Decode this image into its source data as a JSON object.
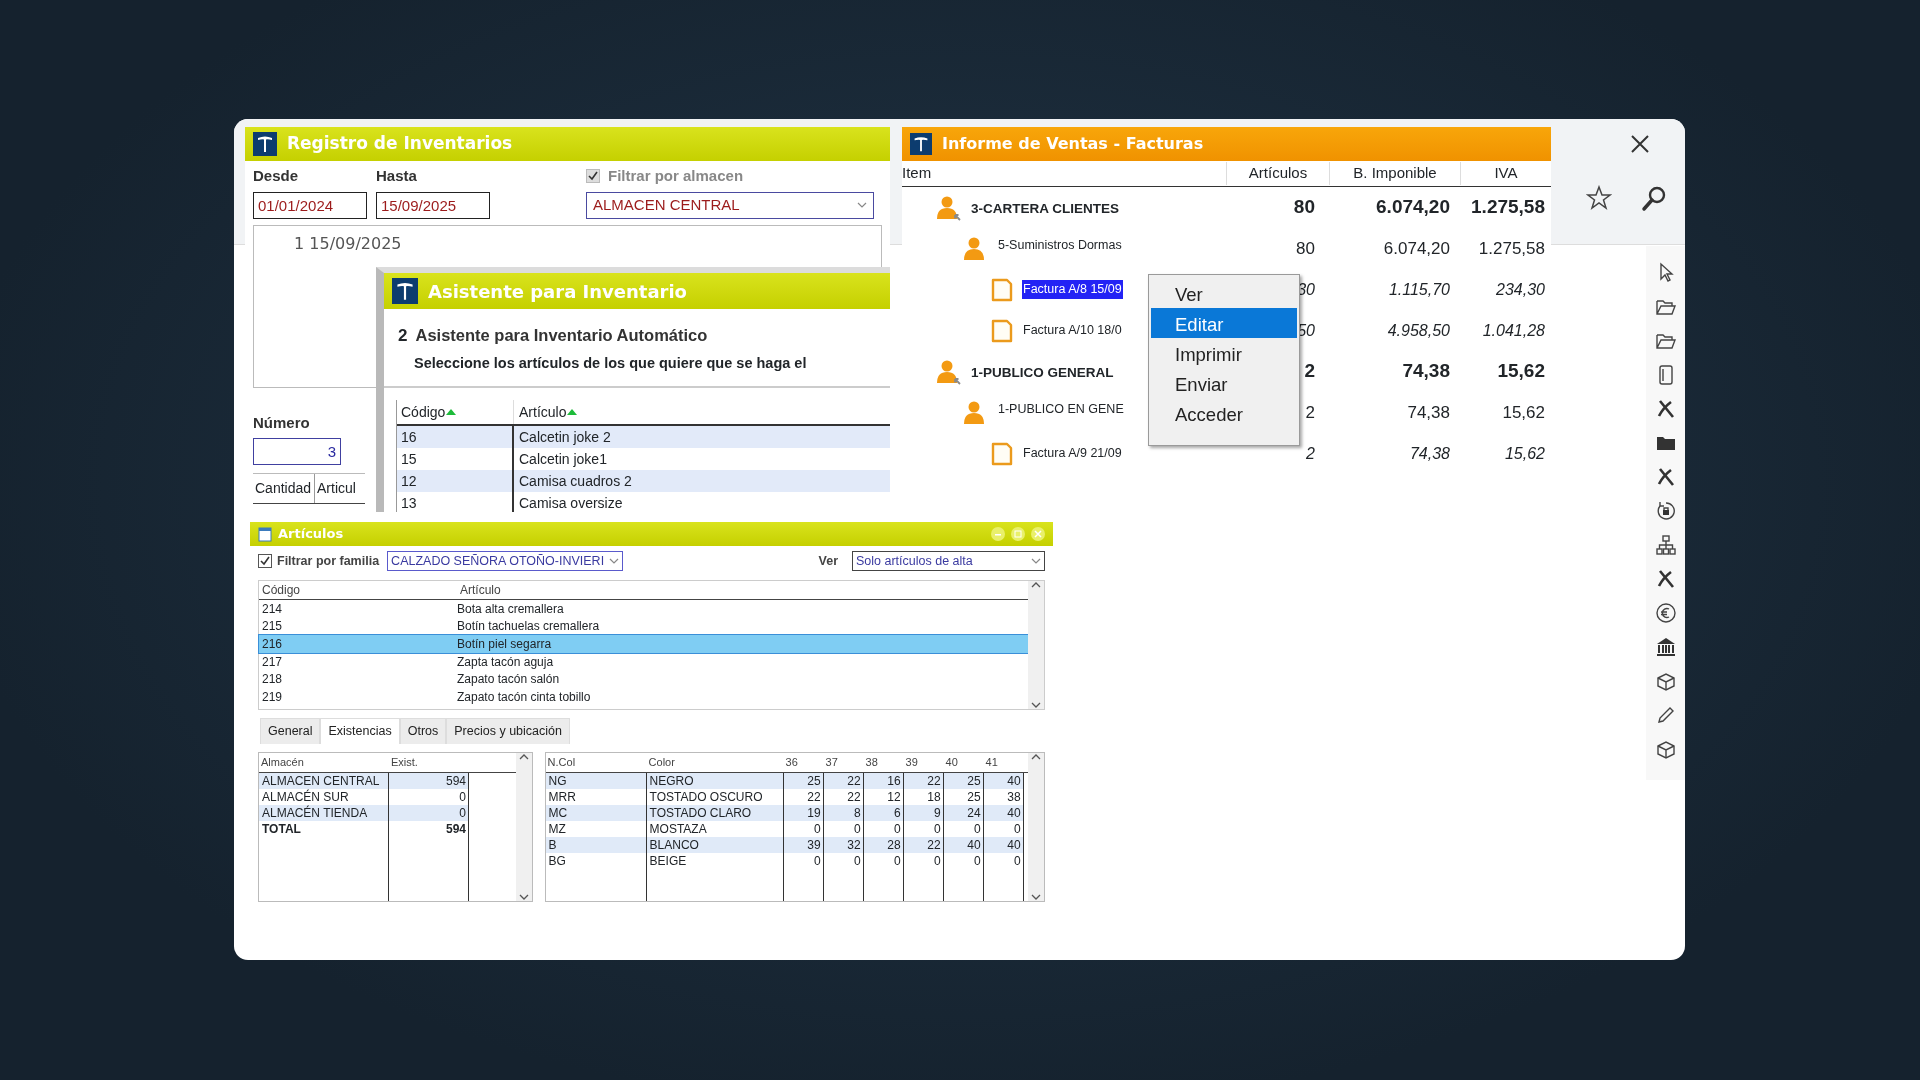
{
  "registro": {
    "title": "Registro de Inventarios",
    "desde": {
      "label": "Desde",
      "value": "01/01/2024"
    },
    "hasta": {
      "label": "Hasta",
      "value": "15/09/2025"
    },
    "almacen_filter": {
      "label": "Filtrar por almacen",
      "checked": true,
      "disabled": true
    },
    "almacen": {
      "value": "ALMACEN CENTRAL"
    },
    "list": [
      "1 15/09/2025"
    ],
    "numero": {
      "label": "Número",
      "value": "3"
    },
    "columns": [
      "Cantidad",
      "Articul"
    ]
  },
  "asistente": {
    "title": "Asistente para Inventario",
    "step": "2",
    "heading": "Asistente para Inventario Automático",
    "instruction": "Seleccione los artículos de los que quiere que se haga el",
    "columns": [
      {
        "label": "Código",
        "sorted": true
      },
      {
        "label": "Artículo",
        "sorted": true
      }
    ],
    "rows": [
      {
        "codigo": "16",
        "articulo": "Calcetin joke 2"
      },
      {
        "codigo": "15",
        "articulo": "Calcetin joke1"
      },
      {
        "codigo": "12",
        "articulo": "Camisa cuadros 2"
      },
      {
        "codigo": "13",
        "articulo": "Camisa oversize"
      }
    ]
  },
  "informe": {
    "title": "Informe de Ventas - Facturas",
    "columns": [
      "Item",
      "Artículos",
      "B. Imponible",
      "IVA"
    ],
    "tree": [
      {
        "kind": "group",
        "label": "3-CARTERA CLIENTES",
        "articulos": "80",
        "base": "6.074,20",
        "iva": "1.275,58",
        "selected": false,
        "children": [
          {
            "kind": "client",
            "label": "5-Suministros Dormas",
            "articulos": "80",
            "base": "6.074,20",
            "iva": "1.275,58",
            "selected": false,
            "children": [
              {
                "kind": "invoice",
                "label": "Factura A/8 15/09",
                "articulos": "30",
                "base": "1.115,70",
                "iva": "234,30",
                "selected": true
              },
              {
                "kind": "invoice",
                "label": "Factura A/10 18/0",
                "articulos": "50",
                "base": "4.958,50",
                "iva": "1.041,28",
                "selected": false
              }
            ]
          }
        ]
      },
      {
        "kind": "group",
        "label": "1-PUBLICO GENERAL",
        "articulos": "2",
        "base": "74,38",
        "iva": "15,62",
        "selected": false,
        "children": [
          {
            "kind": "client",
            "label": "1-PUBLICO EN GENE",
            "articulos": "2",
            "base": "74,38",
            "iva": "15,62",
            "selected": false,
            "children": [
              {
                "kind": "invoice",
                "label": "Factura A/9 21/09",
                "articulos": "2",
                "base": "74,38",
                "iva": "15,62",
                "selected": false
              }
            ]
          }
        ]
      }
    ]
  },
  "context_menu": {
    "items": [
      {
        "label": "Ver",
        "selected": false
      },
      {
        "label": "Editar",
        "selected": true
      },
      {
        "label": "Imprimir",
        "selected": false
      },
      {
        "label": "Enviar",
        "selected": false
      },
      {
        "label": "Acceder",
        "selected": false
      }
    ]
  },
  "articulos": {
    "title": "Artículos",
    "familia_filter": {
      "label": "Filtrar por familia",
      "checked": true
    },
    "familia": {
      "value": "CALZADO SEÑORA OTOÑO-INVIERI"
    },
    "ver": {
      "label": "Ver",
      "value": "Solo artículos de alta"
    },
    "columns": [
      "Código",
      "Artículo"
    ],
    "rows": [
      {
        "codigo": "214",
        "articulo": "Bota alta cremallera",
        "selected": false
      },
      {
        "codigo": "215",
        "articulo": "Botín tachuelas cremallera",
        "selected": false
      },
      {
        "codigo": "216",
        "articulo": "Botín piel segarra",
        "selected": true
      },
      {
        "codigo": "217",
        "articulo": "Zapta tacón aguja",
        "selected": false
      },
      {
        "codigo": "218",
        "articulo": "Zapato tacón salón",
        "selected": false
      },
      {
        "codigo": "219",
        "articulo": "Zapato tacón cinta tobillo",
        "selected": false
      }
    ],
    "tabs": [
      {
        "label": "General",
        "selected": false
      },
      {
        "label": "Existencias",
        "selected": true
      },
      {
        "label": "Otros",
        "selected": false
      },
      {
        "label": "Precios y ubicación",
        "selected": false
      }
    ],
    "stock": {
      "columns": [
        "Almacén",
        "Exist."
      ],
      "rows": [
        {
          "kind": "item",
          "almacen": "ALMACEN CENTRAL",
          "exist": "594"
        },
        {
          "kind": "item",
          "almacen": "ALMACÉN SUR",
          "exist": "0"
        },
        {
          "kind": "item",
          "almacen": "ALMACÉN TIENDA",
          "exist": "0"
        },
        {
          "kind": "total",
          "almacen": "TOTAL",
          "exist": "594"
        }
      ]
    },
    "colors": {
      "columns": [
        "N.Col",
        "Color",
        "36",
        "37",
        "38",
        "39",
        "40",
        "41"
      ],
      "rows": [
        {
          "ncol": "NG",
          "color_name": "NEGRO",
          "sizes": [
            "25",
            "22",
            "16",
            "22",
            "25",
            "40"
          ]
        },
        {
          "ncol": "MRR",
          "color_name": "TOSTADO OSCURO",
          "sizes": [
            "22",
            "22",
            "12",
            "18",
            "25",
            "38"
          ]
        },
        {
          "ncol": "MC",
          "color_name": "TOSTADO CLARO",
          "sizes": [
            "19",
            "8",
            "6",
            "9",
            "24",
            "40"
          ]
        },
        {
          "ncol": "MZ",
          "color_name": "MOSTAZA",
          "sizes": [
            "0",
            "0",
            "0",
            "0",
            "0",
            "0"
          ]
        },
        {
          "ncol": "B",
          "color_name": "BLANCO",
          "sizes": [
            "39",
            "32",
            "28",
            "22",
            "40",
            "40"
          ]
        },
        {
          "ncol": "BG",
          "color_name": "BEIGE",
          "sizes": [
            "0",
            "0",
            "0",
            "0",
            "0",
            "0"
          ]
        }
      ]
    }
  }
}
